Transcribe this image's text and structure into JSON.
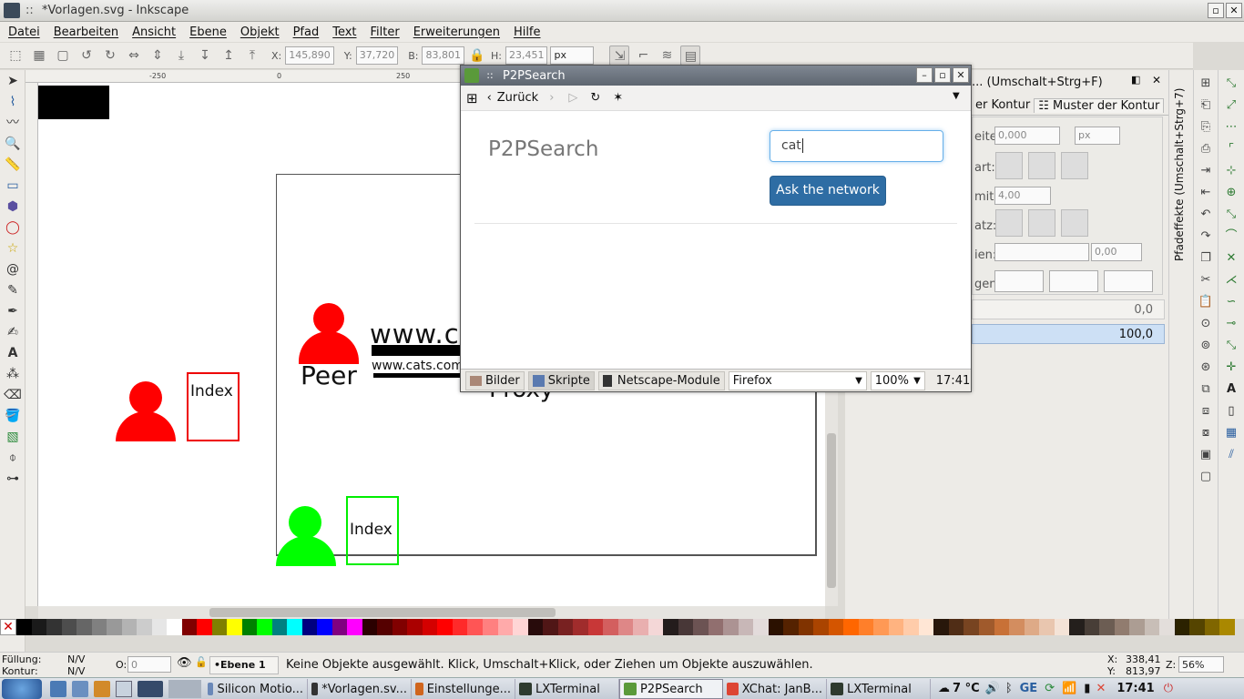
{
  "window": {
    "title": "*Vorlagen.svg - Inkscape",
    "title_prefix": "::"
  },
  "menu": [
    "Datei",
    "Bearbeiten",
    "Ansicht",
    "Ebene",
    "Objekt",
    "Pfad",
    "Text",
    "Filter",
    "Erweiterungen",
    "Hilfe"
  ],
  "toolbar": {
    "x_label": "X:",
    "x": "145,890",
    "y_label": "Y:",
    "y": "37,720",
    "w_label": "B:",
    "w": "83,801",
    "h_label": "H:",
    "h": "23,451",
    "unit": "px"
  },
  "ruler": {
    "h_ticks": [
      "-250",
      "0",
      "250"
    ]
  },
  "canvas": {
    "peer_text": "Peer",
    "url_large": "www.ca",
    "url_small": "www.cats.com",
    "index_red": "Index",
    "index_green": "Index",
    "proxy_text": "Proxy"
  },
  "dock": {
    "title": "... (Umschalt+Strg+F)",
    "tab_stroke": "er Kontur",
    "tab_pattern": "Muster der Kontur",
    "width_label": "eite:",
    "width_value": "0,000",
    "width_unit": "px",
    "join_label": "art:",
    "miter_label": "mit:",
    "miter_value": "4,00",
    "cap_label": "atz:",
    "dash_label": "ien:",
    "dash_value": "0,00",
    "markers_label": "gen:",
    "blur_value": "0,0",
    "opacity_value": "100,0"
  },
  "vtab": {
    "label": "Pfadeffekte (Umschalt+Strg+7)"
  },
  "browser": {
    "title": "P2PSearch",
    "back_label": "Zurück",
    "heading": "P2PSearch",
    "search_value": "cat",
    "ask_button": "Ask the network",
    "status_tabs": [
      "Bilder",
      "Skripte",
      "Netscape-Module"
    ],
    "ua": "Firefox",
    "zoom": "100%",
    "time": "17:41"
  },
  "status": {
    "fill_label": "Füllung:",
    "fill_value": "N/V",
    "stroke_label": "Kontur:",
    "stroke_value": "N/V",
    "opacity_label": "O:",
    "opacity_value": "0",
    "layer": "•Ebene 1",
    "message": "Keine Objekte ausgewählt. Klick, Umschalt+Klick, oder Ziehen um Objekte auszuwählen.",
    "cx_label": "X:",
    "cx": "338,41",
    "cy_label": "Y:",
    "cy": "813,97",
    "zoom_label": "Z:",
    "zoom": "56%"
  },
  "taskbar": {
    "tasks": [
      "Silicon Motio...",
      "*Vorlagen.sv...",
      "Einstellunge...",
      "LXTerminal",
      "P2PSearch",
      "XChat: JanB...",
      "LXTerminal"
    ],
    "temp": "7 °C",
    "lang": "GE",
    "clock": "17:41"
  },
  "palette": [
    "#000000",
    "#1a1a1a",
    "#333333",
    "#4d4d4d",
    "#666666",
    "#808080",
    "#999999",
    "#b3b3b3",
    "#cccccc",
    "#e6e6e6",
    "#ffffff",
    "#800000",
    "#ff0000",
    "#808000",
    "#ffff00",
    "#008000",
    "#00ff00",
    "#008080",
    "#00ffff",
    "#000080",
    "#0000ff",
    "#800080",
    "#ff00ff",
    "#2b0000",
    "#550000",
    "#800000",
    "#aa0000",
    "#d40000",
    "#ff0000",
    "#ff2a2a",
    "#ff5555",
    "#ff8080",
    "#ffaaaa",
    "#ffd5d5",
    "#280b0b",
    "#501616",
    "#782121",
    "#a02c2c",
    "#c83737",
    "#d35f5f",
    "#de8787",
    "#e9afaf",
    "#f4d7d7",
    "#241c1c",
    "#483737",
    "#6c5353",
    "#916f6f",
    "#ac9393",
    "#c8b7b7",
    "#e3dbdb",
    "#2b1100",
    "#552200",
    "#803300",
    "#aa4400",
    "#d45500",
    "#ff6600",
    "#ff7f2a",
    "#ff9955",
    "#ffb380",
    "#ffccaa",
    "#ffe6d5",
    "#28170b",
    "#502d16",
    "#784421",
    "#a05a2c",
    "#c87137",
    "#d38d5f",
    "#deaa87",
    "#e9c6af",
    "#f4e3d7",
    "#241f1c",
    "#483e37",
    "#6c5d53",
    "#917c6f",
    "#ac9d93",
    "#c8beb7",
    "#e3dedb",
    "#2b2200",
    "#554400",
    "#806600",
    "#aa8800"
  ]
}
